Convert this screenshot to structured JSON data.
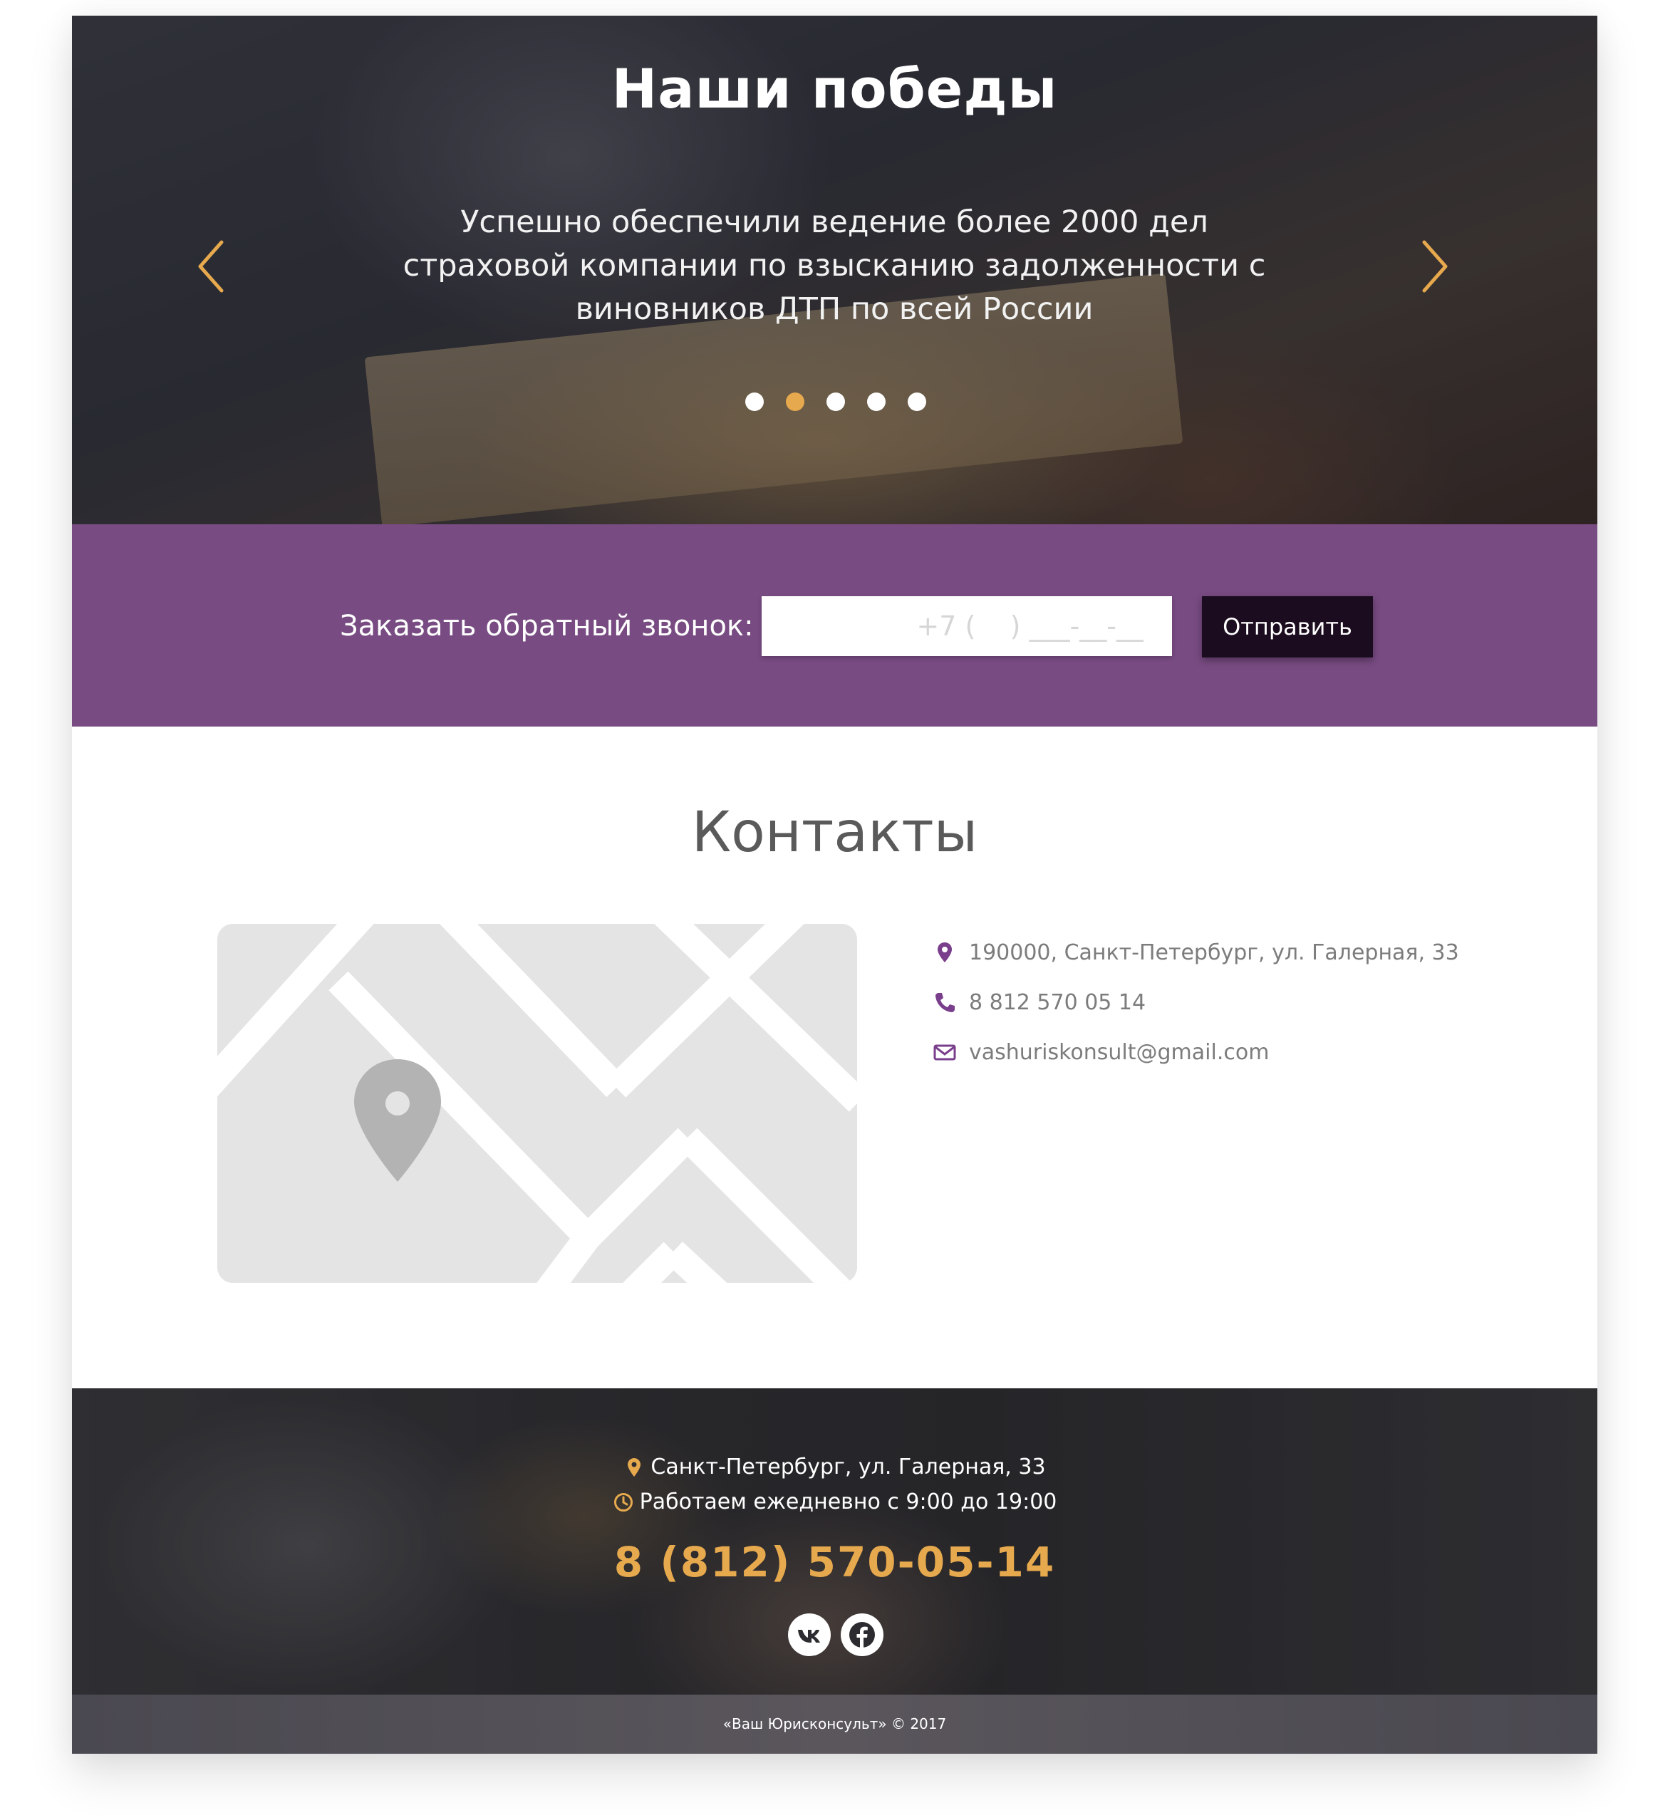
{
  "hero": {
    "title": "Наши победы",
    "text": "Успешно обеспечили ведение более 2000 дел страховой компании по взысканию задолженности с виновников ДТП по всей России",
    "dots_count": 5,
    "active_dot": 2,
    "arrow_color": "#e7a94d"
  },
  "callback": {
    "label": "Заказать обратный звонок:",
    "phone_placeholder": "+7 (    ) ___-__-__",
    "send_label": "Отправить",
    "background": "#784b82"
  },
  "contacts": {
    "title": "Контакты",
    "address": "190000, Санкт-Петербург, ул. Галерная, 33",
    "phone": "8 812 570 05 14",
    "email": "vashuriskonsult@gmail.com",
    "icon_color": "#7a3f8c"
  },
  "footer": {
    "address": "Санкт-Петербург, ул. Галерная, 33",
    "hours": "Работаем ежедневно с 9:00 до 19:00",
    "phone": "8 (812) 570-05-14",
    "socials": [
      "vk-icon",
      "facebook-icon"
    ],
    "copyright": "«Ваш Юрисконсульт» © 2017",
    "accent": "#e7a94d"
  }
}
